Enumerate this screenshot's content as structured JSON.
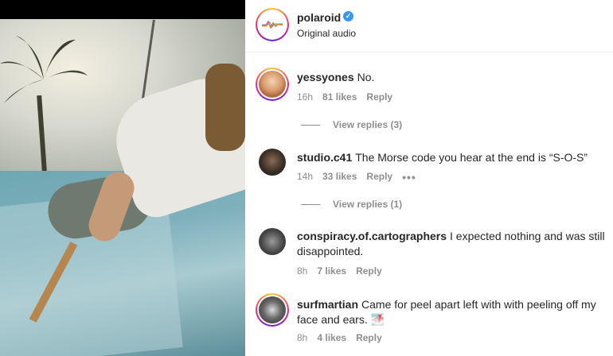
{
  "post": {
    "account": "polaroid",
    "verified_mark": "✓",
    "audio": "Original audio"
  },
  "comments": [
    {
      "username": "yessyones",
      "text": "No.",
      "time": "16h",
      "likes": "81 likes",
      "reply": "Reply",
      "view_replies": "View replies (3)"
    },
    {
      "username": "studio.c41",
      "text": "The Morse code you hear at the end is “S-O-S”",
      "time": "14h",
      "likes": "33 likes",
      "reply": "Reply",
      "more": "•••",
      "view_replies": "View replies (1)"
    },
    {
      "username": "conspiracy.of.cartographers",
      "text": "I expected nothing and was still disappointed.",
      "time": "8h",
      "likes": "7 likes",
      "reply": "Reply"
    },
    {
      "username": "surfmartian",
      "text": "Came for peel apart left with with peeling off my face and ears. 🌁",
      "time": "8h",
      "likes": "4 likes",
      "reply": "Reply"
    }
  ],
  "colors": {
    "text": "#262626",
    "secondary": "#8e8e8e",
    "verified": "#3897f0"
  }
}
